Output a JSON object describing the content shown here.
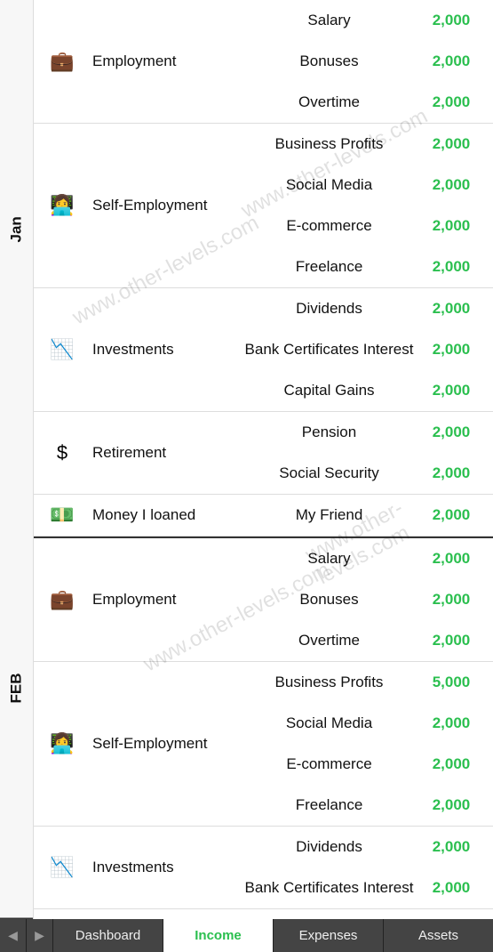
{
  "watermark": "www.other-levels.com",
  "months": [
    {
      "label": "Jan",
      "categories": [
        {
          "icon": "💼",
          "name": "Employment",
          "subs": [
            {
              "name": "Salary",
              "value": "2,000"
            },
            {
              "name": "Bonuses",
              "value": "2,000"
            },
            {
              "name": "Overtime",
              "value": "2,000"
            }
          ]
        },
        {
          "icon": "👩‍💻",
          "name": "Self-Employment",
          "subs": [
            {
              "name": "Business Profits",
              "value": "2,000"
            },
            {
              "name": "Social Media",
              "value": "2,000"
            },
            {
              "name": "E-commerce",
              "value": "2,000"
            },
            {
              "name": "Freelance",
              "value": "2,000"
            }
          ]
        },
        {
          "icon": "📉",
          "name": "Investments",
          "subs": [
            {
              "name": "Dividends",
              "value": "2,000"
            },
            {
              "name": "Bank Certificates Interest",
              "value": "2,000"
            },
            {
              "name": "Capital Gains",
              "value": "2,000"
            }
          ]
        },
        {
          "icon": "$",
          "name": "Retirement",
          "subs": [
            {
              "name": "Pension",
              "value": "2,000"
            },
            {
              "name": "Social Security",
              "value": "2,000"
            }
          ]
        },
        {
          "icon": "💵",
          "name": "Money I loaned",
          "subs": [
            {
              "name": "My Friend",
              "value": "2,000"
            }
          ]
        }
      ]
    },
    {
      "label": "FEB",
      "categories": [
        {
          "icon": "💼",
          "name": "Employment",
          "subs": [
            {
              "name": "Salary",
              "value": "2,000"
            },
            {
              "name": "Bonuses",
              "value": "2,000"
            },
            {
              "name": "Overtime",
              "value": "2,000"
            }
          ]
        },
        {
          "icon": "👩‍💻",
          "name": "Self-Employment",
          "subs": [
            {
              "name": "Business Profits",
              "value": "5,000"
            },
            {
              "name": "Social Media",
              "value": "2,000"
            },
            {
              "name": "E-commerce",
              "value": "2,000"
            },
            {
              "name": "Freelance",
              "value": "2,000"
            }
          ]
        },
        {
          "icon": "📉",
          "name": "Investments",
          "subs": [
            {
              "name": "Dividends",
              "value": "2,000"
            },
            {
              "name": "Bank Certificates Interest",
              "value": "2,000"
            }
          ]
        }
      ]
    }
  ],
  "nav": {
    "tabs": [
      "Dashboard",
      "Income",
      "Expenses",
      "Assets"
    ],
    "active": "Income"
  }
}
